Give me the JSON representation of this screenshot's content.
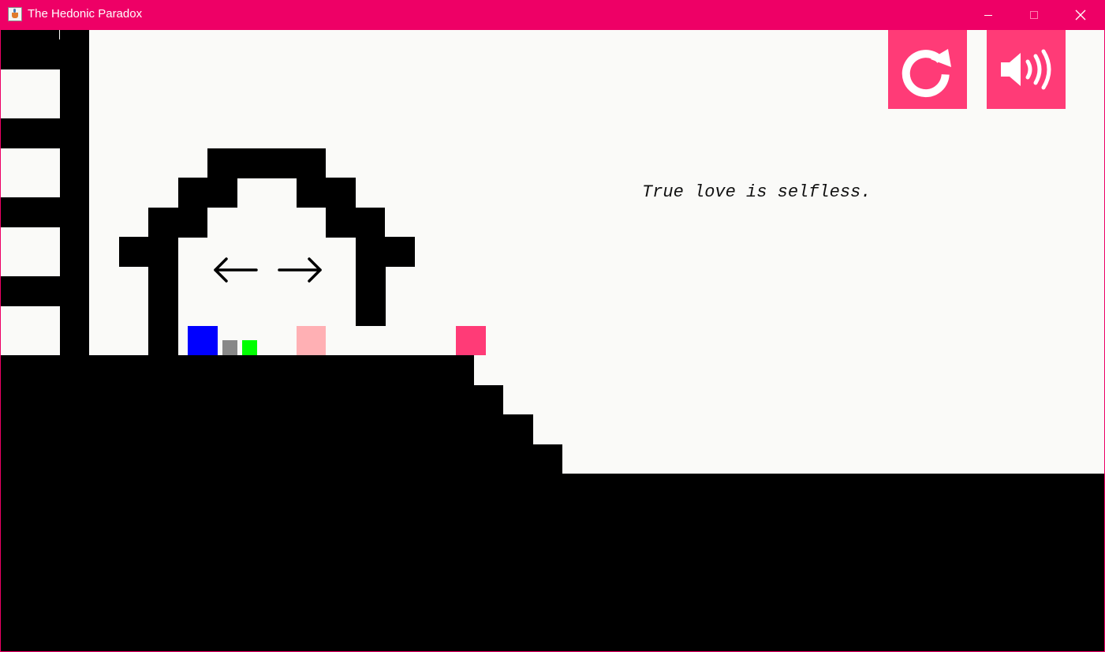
{
  "window": {
    "title": "The Hedonic Paradox",
    "app_icon": "java-cup-icon",
    "controls": [
      "minimize-icon",
      "maximize-icon",
      "close-icon"
    ],
    "titlebar_color": "#ee0066"
  },
  "game": {
    "message": "True love is selfless.",
    "hint": {
      "left_arrow_icon": "arrow-left-icon",
      "right_arrow_icon": "arrow-right-icon"
    },
    "buttons": [
      {
        "name": "restart",
        "icon": "restart-icon"
      },
      {
        "name": "sound",
        "icon": "speaker-volume-icon"
      }
    ],
    "colors": {
      "background": "#fafaf8",
      "terrain": "#000000",
      "button": "#ff3b77",
      "player_blue": "#0000ff",
      "small_gray": "#888888",
      "small_green": "#00ff00",
      "light_pink": "#ffb0b4",
      "goal_pink": "#ff3b77"
    }
  }
}
